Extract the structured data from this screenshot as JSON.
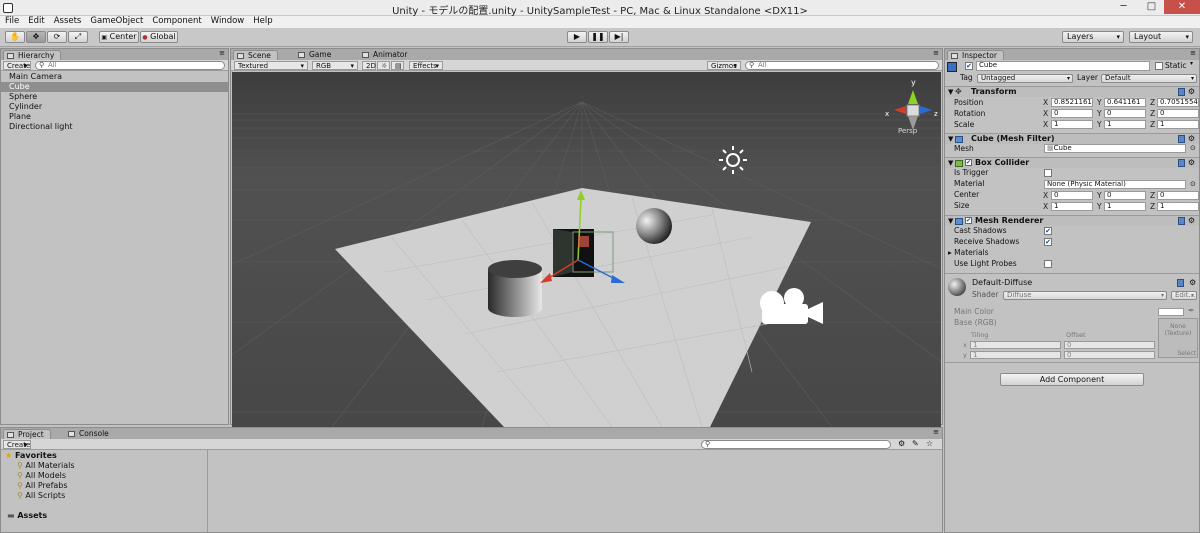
{
  "window": {
    "title": "Unity - モデルの配置.unity - UnitySampleTest - PC, Mac & Linux Standalone <DX11>",
    "minimize": "─",
    "maximize": "□",
    "close": "✕"
  },
  "menu": [
    "File",
    "Edit",
    "Assets",
    "GameObject",
    "Component",
    "Window",
    "Help"
  ],
  "toolbar": {
    "pivot": "Center",
    "space": "Global",
    "layers": "Layers",
    "layout": "Layout"
  },
  "hierarchy": {
    "tab": "Hierarchy",
    "create": "Create",
    "search_placeholder": "All",
    "items": [
      "Main Camera",
      "Cube",
      "Sphere",
      "Cylinder",
      "Plane",
      "Directional light"
    ],
    "selected_index": 1
  },
  "scene": {
    "tabs": [
      "Scene",
      "Game",
      "Animator"
    ],
    "draw_mode": "Textured",
    "render_mode": "RGB",
    "mode_2d": "2D",
    "effects": "Effects",
    "gizmos": "Gizmos",
    "search_placeholder": "All",
    "persp": "Persp",
    "gizmo_axes": [
      "y",
      "x",
      "z"
    ]
  },
  "project": {
    "tabs": [
      "Project",
      "Console"
    ],
    "create": "Create",
    "favorites_label": "Favorites",
    "favorites": [
      "All Materials",
      "All Models",
      "All Prefabs",
      "All Scripts"
    ],
    "assets_label": "Assets"
  },
  "inspector": {
    "tab": "Inspector",
    "object_name": "Cube",
    "static_label": "Static",
    "tag_label": "Tag",
    "tag_value": "Untagged",
    "layer_label": "Layer",
    "layer_value": "Default",
    "transform": {
      "title": "Transform",
      "position_label": "Position",
      "rotation_label": "Rotation",
      "scale_label": "Scale",
      "position": [
        "0.8521161",
        "0.641161",
        "0.7051554"
      ],
      "rotation": [
        "0",
        "0",
        "0"
      ],
      "scale": [
        "1",
        "1",
        "1"
      ]
    },
    "axes": [
      "X",
      "Y",
      "Z"
    ],
    "mesh_filter": {
      "title": "Cube (Mesh Filter)",
      "mesh_label": "Mesh",
      "mesh_value": "Cube"
    },
    "box_collider": {
      "title": "Box Collider",
      "is_trigger_label": "Is Trigger",
      "material_label": "Material",
      "material_value": "None (Physic Material)",
      "center_label": "Center",
      "size_label": "Size",
      "center": [
        "0",
        "0",
        "0"
      ],
      "size": [
        "1",
        "1",
        "1"
      ]
    },
    "mesh_renderer": {
      "title": "Mesh Renderer",
      "cast_shadows_label": "Cast Shadows",
      "receive_shadows_label": "Receive Shadows",
      "materials_label": "Materials",
      "light_probes_label": "Use Light Probes"
    },
    "material": {
      "name": "Default-Diffuse",
      "shader_label": "Shader",
      "shader_value": "Diffuse",
      "edit_label": "Edit...",
      "main_color_label": "Main Color",
      "base_label": "Base (RGB)",
      "tiling_label": "Tiling",
      "offset_label": "Offset",
      "tiling": [
        "1",
        "1"
      ],
      "offset": [
        "0",
        "0"
      ],
      "texture_none": "None",
      "texture_type": "(Texture)",
      "select_label": "Select",
      "x_label": "x",
      "y_label": "y"
    },
    "add_component": "Add Component"
  },
  "colors": {
    "selection": "#8e8e8e",
    "scene_bg": "#4a4a4a",
    "ground": "#cfcfcf",
    "close_button": "#c7504a"
  }
}
